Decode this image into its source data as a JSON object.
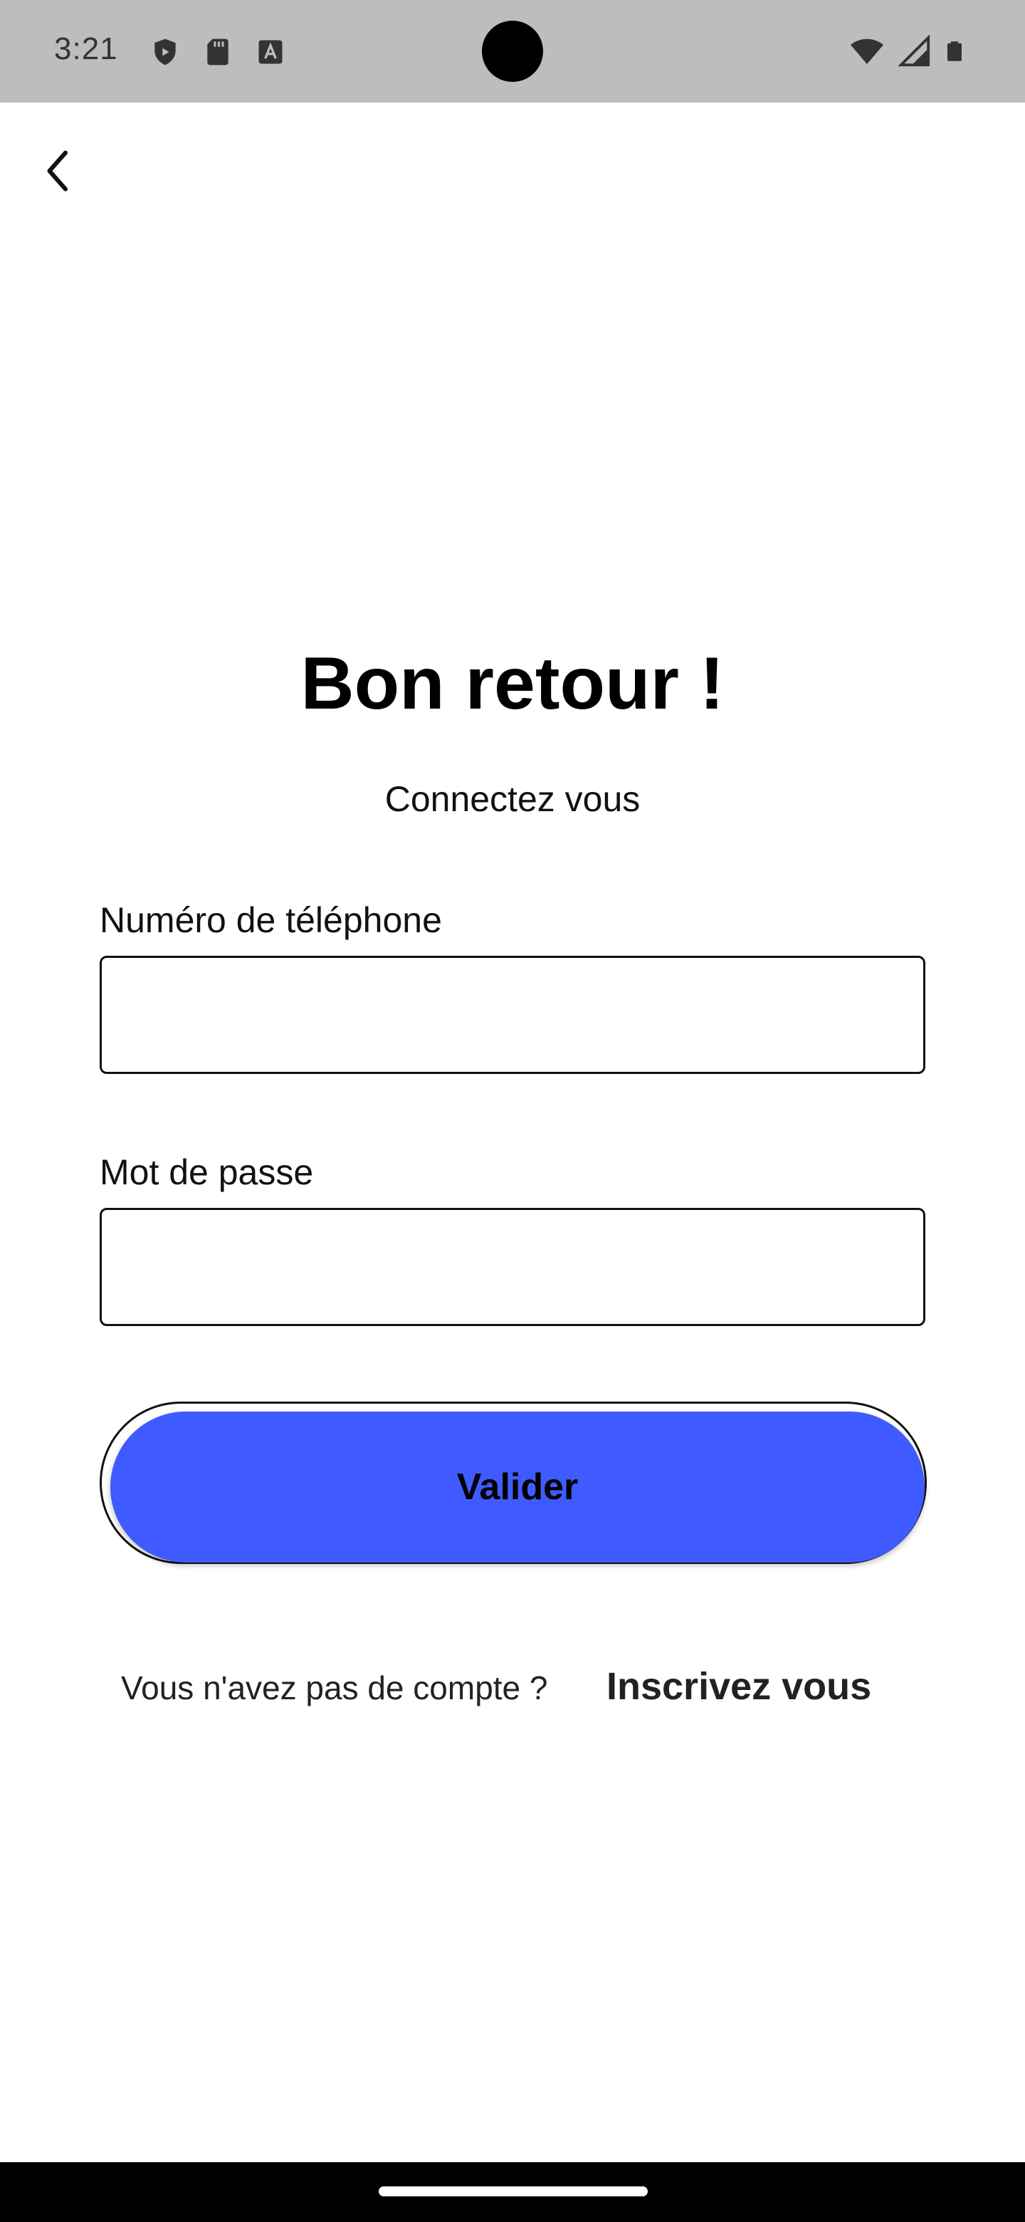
{
  "status_bar": {
    "time": "3:21",
    "icons_left": [
      "shield-icon",
      "sd-card-icon",
      "font-a-icon"
    ],
    "icons_right": [
      "wifi-icon",
      "signal-icon",
      "battery-icon"
    ]
  },
  "nav": {
    "back_icon": "chevron-left-icon"
  },
  "login": {
    "title": "Bon retour !",
    "subtitle": "Connectez vous",
    "phone_label": "Numéro de téléphone",
    "phone_value": "",
    "password_label": "Mot de passe",
    "password_value": "",
    "submit_label": "Valider",
    "signup_prompt": "Vous n'avez pas de compte ?",
    "signup_link": "Inscrivez vous"
  },
  "colors": {
    "status_bar": "#bdbdbd",
    "primary_button": "#3f5bff",
    "background": "#ffffff",
    "nav_bar": "#000000"
  }
}
